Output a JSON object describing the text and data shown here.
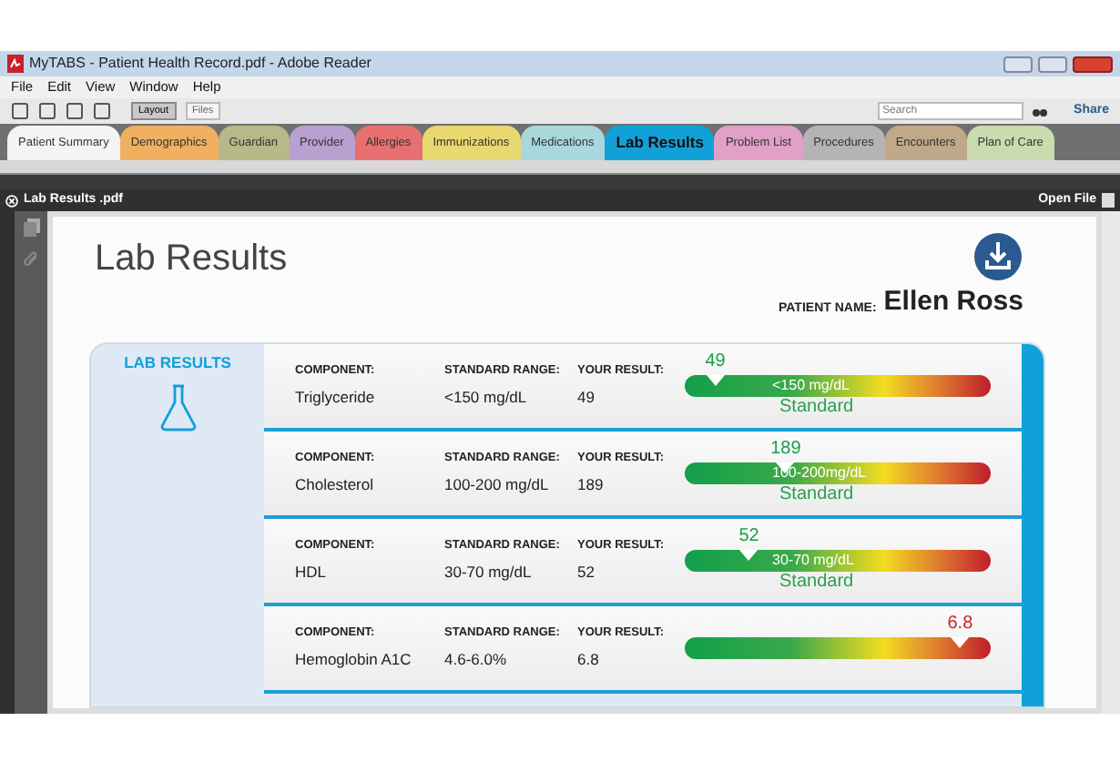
{
  "window": {
    "title": "MyTABS - Patient Health Record.pdf - Adobe Reader"
  },
  "menu": [
    "File",
    "Edit",
    "View",
    "Window",
    "Help"
  ],
  "toolbar": {
    "layout_button": "Layout",
    "files_button": "Files",
    "search": {
      "placeholder": "Search"
    },
    "share": "Share"
  },
  "tabs": [
    {
      "label": "Patient Summary",
      "color": "#f4f4f4",
      "selected": false
    },
    {
      "label": "Demographics",
      "color": "#f0b060",
      "selected": false
    },
    {
      "label": "Guardian",
      "color": "#b8b888",
      "selected": false
    },
    {
      "label": "Provider",
      "color": "#b8a0d0",
      "selected": false
    },
    {
      "label": "Allergies",
      "color": "#e87070",
      "selected": false
    },
    {
      "label": "Immunizations",
      "color": "#e8d870",
      "selected": false
    },
    {
      "label": "Medications",
      "color": "#a8d8dc",
      "selected": false
    },
    {
      "label": "Lab Results",
      "color": "#12a0d8",
      "selected": true
    },
    {
      "label": "Problem List",
      "color": "#e0a0c8",
      "selected": false
    },
    {
      "label": "Procedures",
      "color": "#b4b4b4",
      "selected": false
    },
    {
      "label": "Encounters",
      "color": "#c0a888",
      "selected": false
    },
    {
      "label": "Plan of Care",
      "color": "#c8dcb0",
      "selected": false
    }
  ],
  "document": {
    "file_name": "Lab Results .pdf",
    "open_file": "Open File"
  },
  "page": {
    "title": "Lab Results",
    "patient_label": "PATIENT NAME:",
    "patient_name": "Ellen Ross",
    "section": "LAB RESULTS",
    "results": [
      {
        "component_label": "COMPONENT:",
        "component": "Triglyceride",
        "range_label": "STANDARD RANGE:",
        "range": "<150 mg/dL",
        "result_label": "YOUR RESULT:",
        "result": "49",
        "marker": "49",
        "level": 0.1,
        "color": "#1a9e4a",
        "bar_range": "<150 mg/dL",
        "standard": "Standard"
      },
      {
        "component_label": "COMPONENT:",
        "component": "Cholesterol",
        "range_label": "STANDARD RANGE:",
        "range": "100-200 mg/dL",
        "result_label": "YOUR RESULT:",
        "result": "189",
        "marker": "189",
        "level": 0.33,
        "color": "#1a9e4a",
        "bar_range": "100-200mg/dL",
        "standard": "Standard"
      },
      {
        "component_label": "COMPONENT:",
        "component": "HDL",
        "range_label": "STANDARD RANGE:",
        "range": "30-70 mg/dL",
        "result_label": "YOUR RESULT:",
        "result": "52",
        "marker": "52",
        "level": 0.21,
        "color": "#1a9e4a",
        "bar_range": "30-70 mg/dL",
        "standard": "Standard"
      },
      {
        "component_label": "COMPONENT:",
        "component": "Hemoglobin A1C",
        "range_label": "STANDARD RANGE:",
        "range": "4.6-6.0%",
        "result_label": "YOUR RESULT:",
        "result": "6.8",
        "marker": "6.8",
        "level": 0.9,
        "color": "#c8282c"
      }
    ]
  }
}
